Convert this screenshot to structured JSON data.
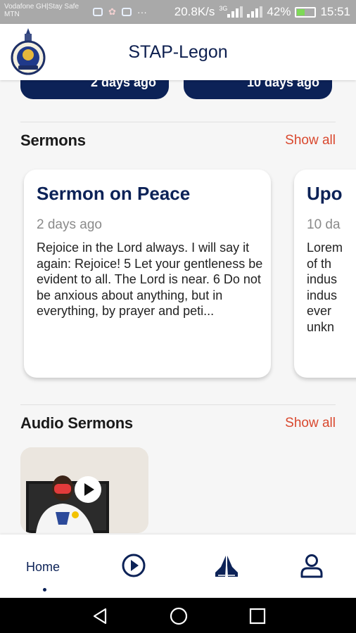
{
  "statusbar": {
    "carrier_line1": "Vodafone GH|Stay Safe",
    "carrier_line2": "MTN",
    "speed": "20.8K/s",
    "network": "3G",
    "battery": "42%",
    "time": "15:51",
    "battery_level": 0.42
  },
  "header": {
    "title": "STAP-Legon"
  },
  "previous_cards": [
    {
      "date": "2 days ago"
    },
    {
      "date": "10 days ago"
    }
  ],
  "sermons": {
    "heading": "Sermons",
    "show_all": "Show all",
    "cards": [
      {
        "title": "Sermon on Peace",
        "date": "2 days ago",
        "excerpt": "Rejoice in the Lord always. I will say it again: Rejoice! 5 Let your gentleness be evident to all. The Lord is near. 6 Do not be anxious about anything, but in everything, by prayer and peti..."
      },
      {
        "title": "Upo",
        "date": "10 da",
        "excerpt_lines": [
          "Lorem",
          "of th",
          "indus",
          "indus",
          "ever",
          "unkn"
        ]
      }
    ]
  },
  "audio_sermons": {
    "heading": "Audio Sermons",
    "show_all": "Show all"
  },
  "bottom_nav": {
    "home_label": "Home",
    "icons": [
      "play-circle-icon",
      "praying-hands-icon",
      "profile-icon"
    ]
  },
  "colors": {
    "brand_navy": "#0c2257",
    "accent_red": "#d9482e"
  }
}
